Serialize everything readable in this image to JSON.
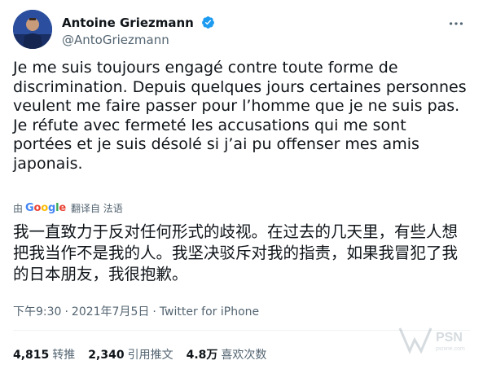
{
  "author": {
    "display_name": "Antoine Griezmann",
    "handle": "@AntoGriezmann"
  },
  "tweet": {
    "text": "Je me suis toujours engagé contre toute forme de discrimination. Depuis quelques jours certaines personnes veulent me faire passer pour l’homme que je ne suis pas. Je réfute avec fermeté les accusations qui me sont portées et je suis désolé si j’ai pu offenser mes amis japonais.",
    "translation_prefix": "由",
    "translation_suffix": "翻译自 法语",
    "translated_text": "我一直致力于反对任何形式的歧视。在过去的几天里，有些人想把我当作不是我的人。我坚决驳斥对我的指责，如果我冒犯了我的日本朋友，我很抱歉。",
    "time": "下午9:30",
    "date": "2021年7月5日",
    "source": "Twitter for iPhone"
  },
  "stats": {
    "retweets_count": "4,815",
    "retweets_label": "转推",
    "quotes_count": "2,340",
    "quotes_label": "引用推文",
    "likes_count": "4.8万",
    "likes_label": "喜欢次数"
  },
  "watermark": {
    "brand": "PSN",
    "sub": "psnine.com"
  },
  "colors": {
    "verified": "#1d9bf0",
    "secondary_text": "#536471"
  }
}
